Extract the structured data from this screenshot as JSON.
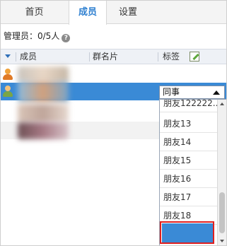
{
  "tabs": [
    {
      "label": "首页",
      "active": false
    },
    {
      "label": "成员",
      "active": true
    },
    {
      "label": "设置",
      "active": false
    }
  ],
  "admin": {
    "text": "管理员：0/5人",
    "help_icon": "question-circle-icon"
  },
  "columns": {
    "member": "成员",
    "card": "群名片",
    "tag": "标签"
  },
  "select": {
    "value": "同事"
  },
  "options": [
    "朋友122222...",
    "朋友13",
    "朋友14",
    "朋友15",
    "朋友16",
    "朋友17",
    "朋友18",
    ""
  ],
  "colors": {
    "accent": "#2d7fd0",
    "selection": "#3a8ad6",
    "highlight_box": "#e02020"
  }
}
